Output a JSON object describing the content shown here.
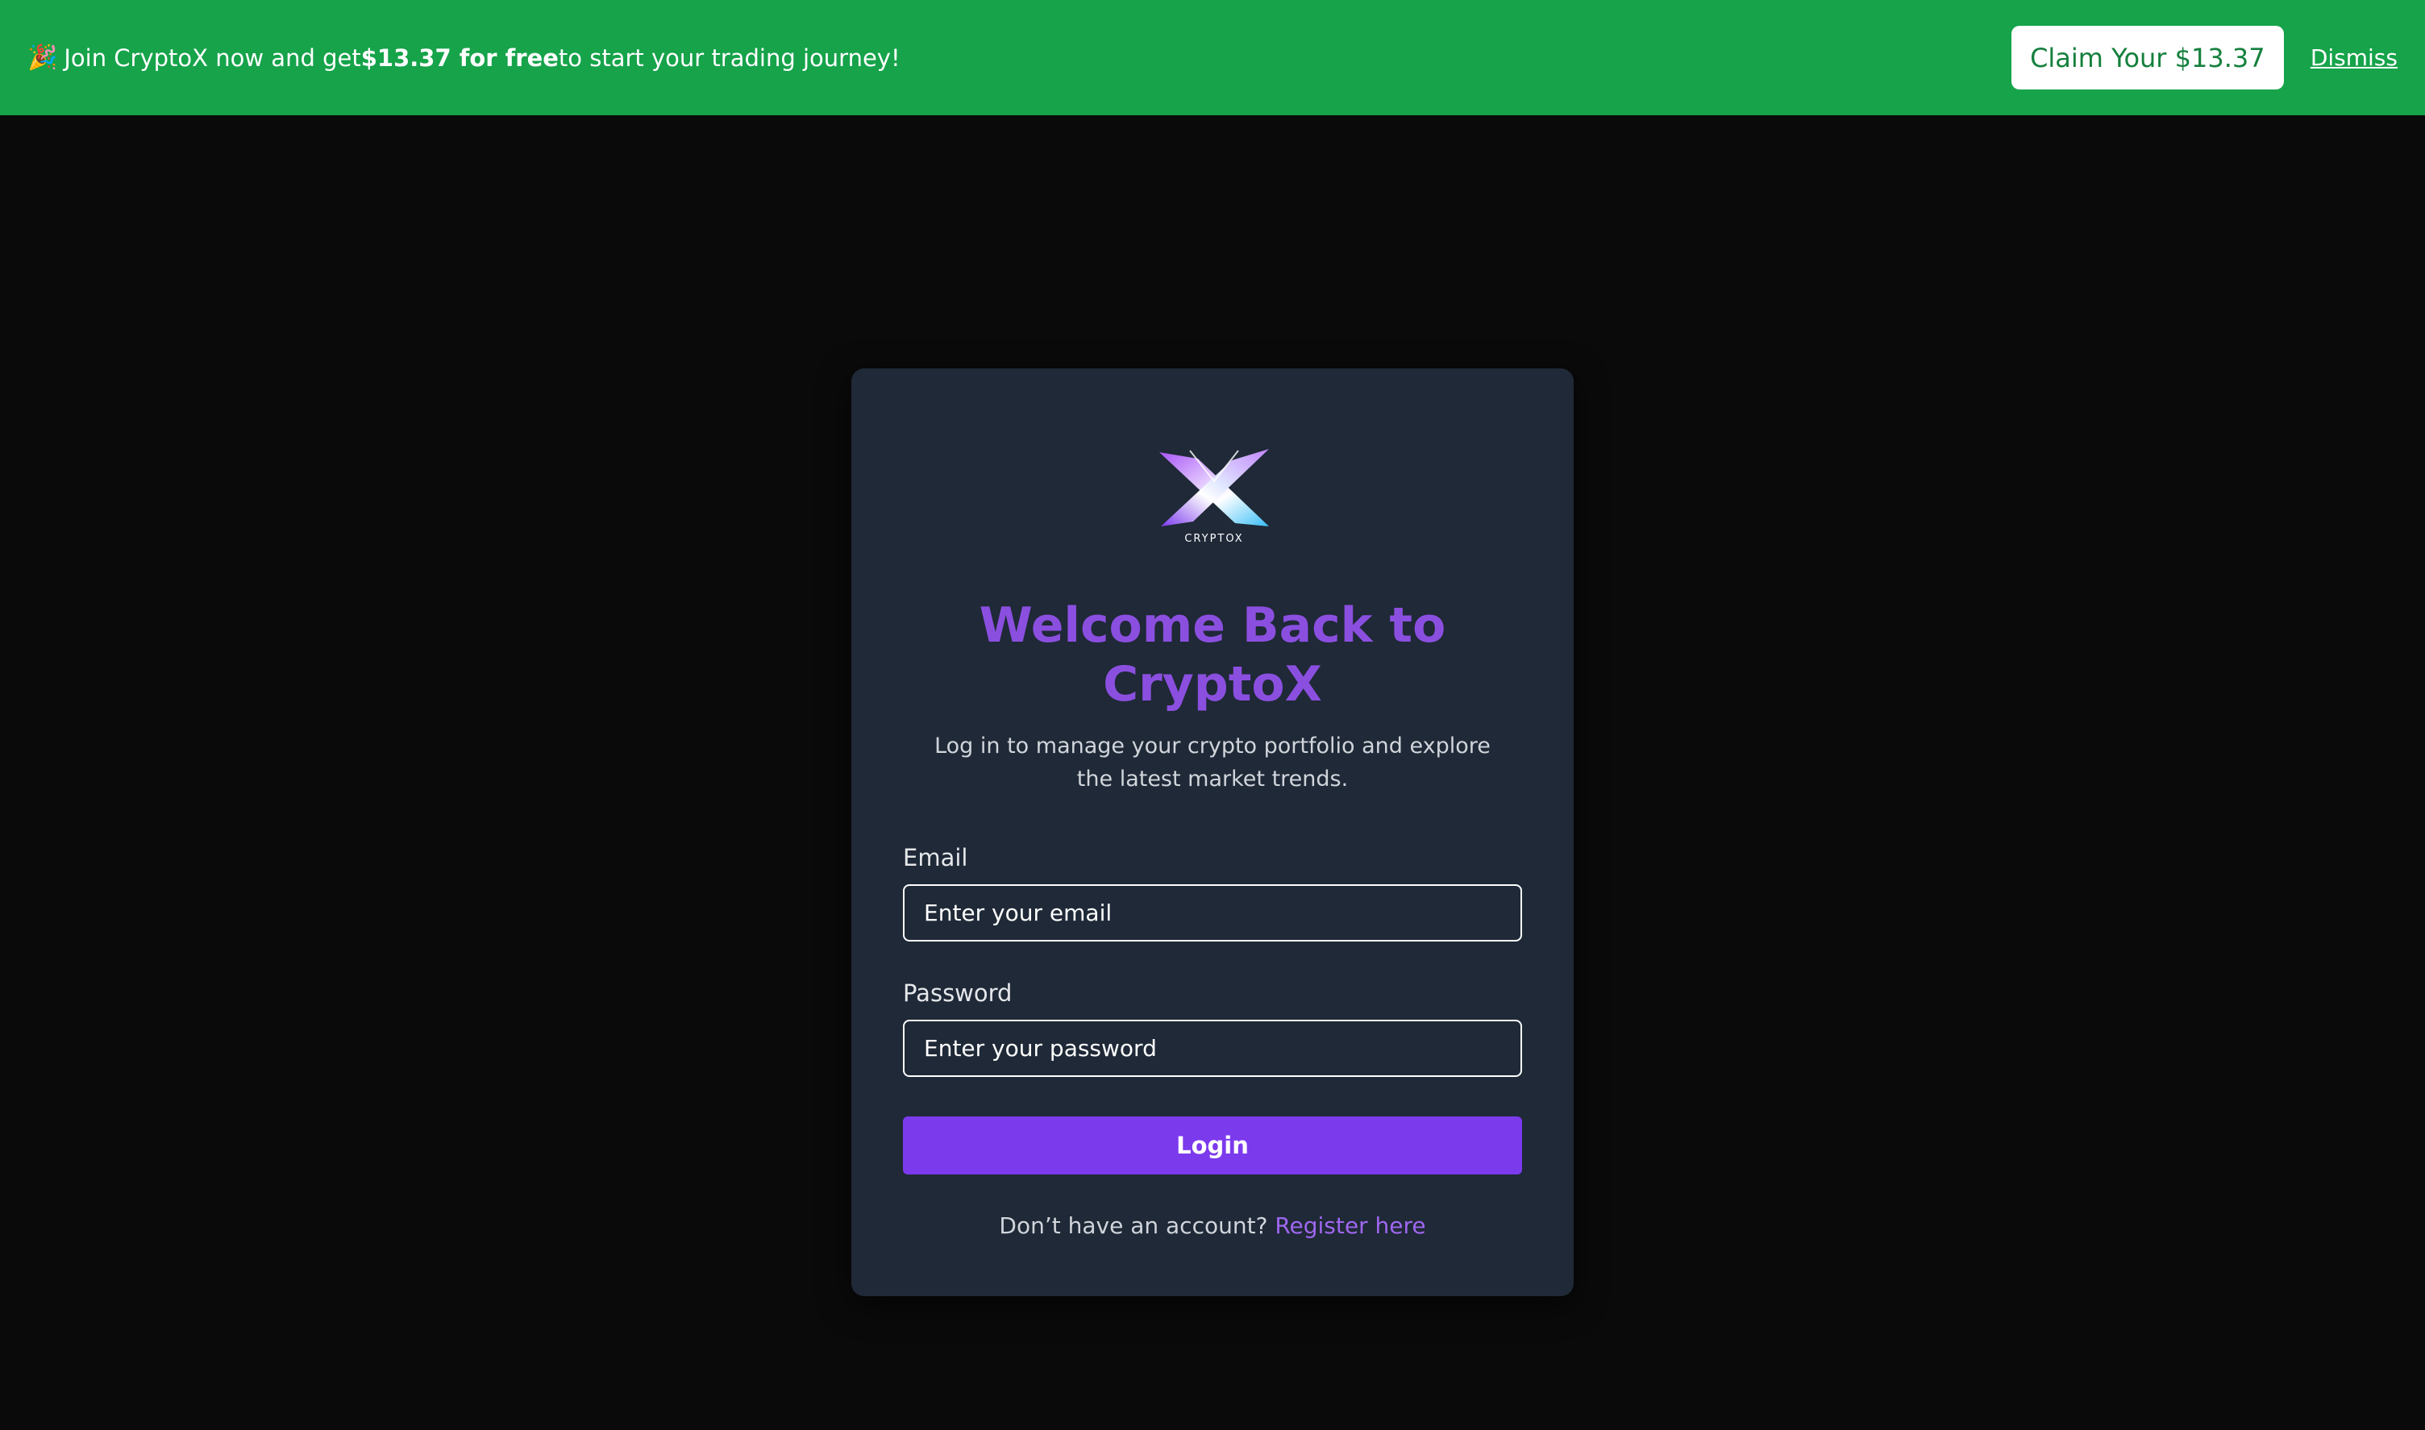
{
  "banner": {
    "emoji": "🎉",
    "text_before": "Join CryptoX now and get ",
    "text_bold": "$13.37 for free",
    "text_after": " to start your trading journey!",
    "claim_label": "Claim Your $13.37",
    "dismiss_label": "Dismiss",
    "background_color": "#16a34a"
  },
  "login": {
    "logo_text": "CRYPTOX",
    "title": "Welcome Back to CryptoX",
    "subtitle": "Log in to manage your crypto portfolio and explore the latest market trends.",
    "email_label": "Email",
    "email_placeholder": "Enter your email",
    "password_label": "Password",
    "password_placeholder": "Enter your password",
    "login_label": "Login",
    "register_prompt": "Don’t have an account? ",
    "register_link": "Register here",
    "accent_color": "#7c3aed",
    "title_color": "#8b4fe0"
  }
}
